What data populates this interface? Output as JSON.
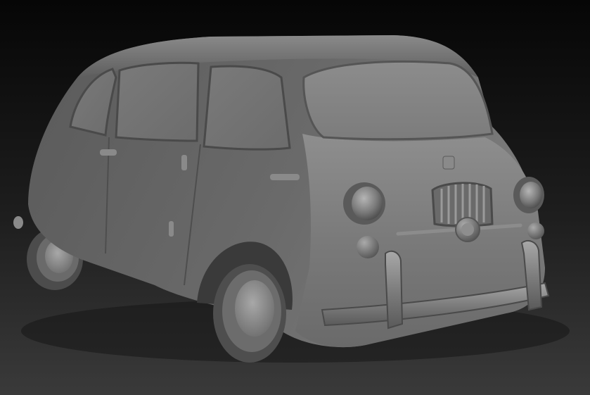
{
  "scene": {
    "subject": "car-model-render",
    "colors": {
      "background_top": "#060606",
      "background_bottom": "#3a3a3a",
      "body_light": "#9a9a9a",
      "body_mid": "#6e6e6e",
      "body_dark": "#3e3e3e",
      "glass": "#858585",
      "tire": "#555555"
    },
    "icons": [
      "car-body-icon",
      "headlight-icon",
      "grille-icon",
      "bumper-icon",
      "wheel-icon"
    ]
  }
}
